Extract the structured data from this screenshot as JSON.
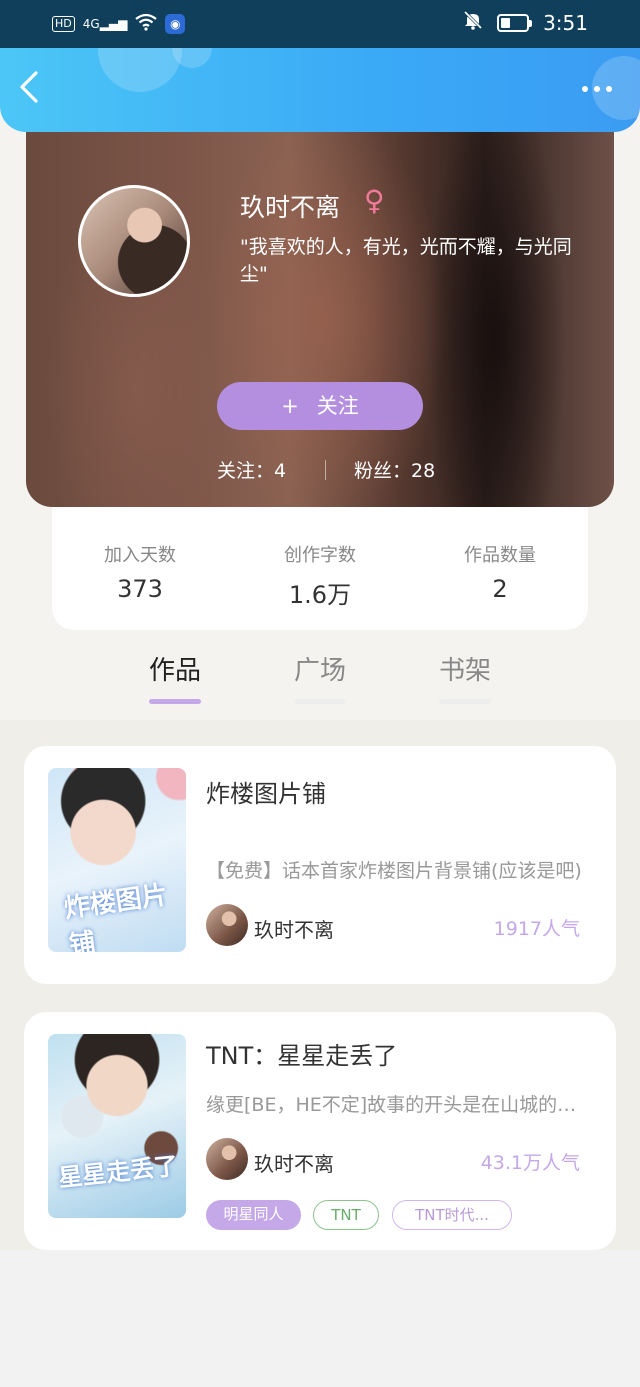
{
  "status_bar": {
    "hd_badge": "HD",
    "signal": "4G",
    "time": "3:51",
    "icons": [
      "hd-icon",
      "signal-icon",
      "wifi-icon",
      "bulb-icon",
      "mute-bell-icon",
      "battery-icon"
    ]
  },
  "nav": {
    "back_icon": "chevron-left-icon",
    "more_icon": "more-dots-icon"
  },
  "profile": {
    "username": "玖时不离",
    "gender_symbol": "♀",
    "signature": "\"我喜欢的人，有光，光而不耀，与光同尘\"",
    "follow_plus": "+",
    "follow_label": "关注",
    "following_label": "关注：",
    "following_count": "4",
    "fans_label": "粉丝：",
    "fans_count": "28"
  },
  "stats": [
    {
      "label": "加入天数",
      "value": "373"
    },
    {
      "label": "创作字数",
      "value": "1.6万"
    },
    {
      "label": "作品数量",
      "value": "2"
    }
  ],
  "tabs": [
    {
      "label": "作品",
      "active": true
    },
    {
      "label": "广场",
      "active": false
    },
    {
      "label": "书架",
      "active": false
    }
  ],
  "works": [
    {
      "title": "炸楼图片铺",
      "cover_text": "炸楼图片铺",
      "description": "【免费】话本首家炸楼图片背景铺(应该是吧)",
      "author": "玖时不离",
      "popularity": "1917人气",
      "tags": []
    },
    {
      "title": "TNT：星星走丢了",
      "cover_text": "星星走丢了",
      "description": "缘更[BE，HE不定]故事的开头是在山城的小巷",
      "author": "玖时不离",
      "popularity": "43.1万人气",
      "tags": [
        "明星同人",
        "TNT",
        "TNT时代..."
      ]
    }
  ],
  "colors": {
    "nav_blue": "#3aa9f6",
    "accent_purple": "#c5a8e8",
    "follow_button": "#b48fe0",
    "gender_pink": "#f07a9a",
    "tag_green": "#8cc38c"
  }
}
